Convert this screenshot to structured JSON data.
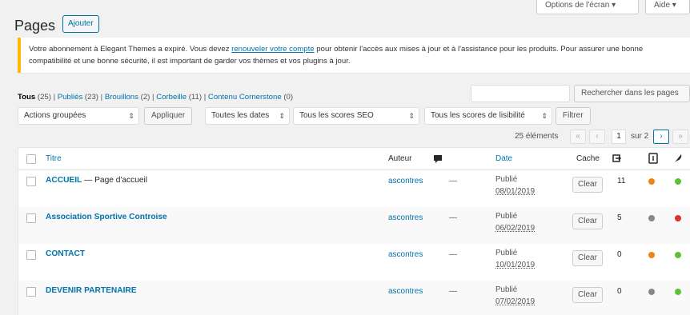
{
  "top_buttons": {
    "screen_options": "Options de l'écran ▾",
    "help": "Aide ▾"
  },
  "page": {
    "title": "Pages",
    "add_button": "Ajouter"
  },
  "notice": {
    "text_before": "Votre abonnement à Elegant Themes a expiré. Vous devez ",
    "link": "renouveler votre compte",
    "text_after": " pour obtenir l'accès aux mises à jour et à l'assistance pour les produits. Pour assurer une bonne compatibilité et une bonne sécurité, il est important de garder vos thèmes et vos plugins à jour."
  },
  "filters_links": [
    {
      "label": "Tous",
      "count": "(25)"
    },
    {
      "label": "Publiés",
      "count": "(23)"
    },
    {
      "label": "Brouillons",
      "count": "(2)"
    },
    {
      "label": "Corbeille",
      "count": "(11)"
    },
    {
      "label": "Contenu Cornerstone",
      "count": "(0)"
    }
  ],
  "search": {
    "placeholder": "",
    "button": "Rechercher dans les pages"
  },
  "toolbar": {
    "bulk_actions": "Actions groupées",
    "apply": "Appliquer",
    "dates": "Toutes les dates",
    "seo": "Tous les scores SEO",
    "readability": "Tous les scores de lisibilité",
    "filter": "Filtrer"
  },
  "pagination": {
    "items": "25 éléments",
    "current": "1",
    "of": "sur 2",
    "first": "«",
    "prev": "‹",
    "next": "›",
    "last": "»"
  },
  "columns": {
    "title": "Titre",
    "author": "Auteur",
    "date": "Date",
    "cache": "Cache"
  },
  "rows": [
    {
      "title": "ACCUEIL",
      "suffix": " — Page d'accueil",
      "author": "ascontres",
      "comments": "—",
      "status": "Publié",
      "date": "08/01/2019",
      "cache": "Clear",
      "links": "11",
      "seo": "#f0821e",
      "readability": "#5bc236"
    },
    {
      "title": "Association Sportive Controise",
      "suffix": "",
      "author": "ascontres",
      "comments": "—",
      "status": "Publié",
      "date": "06/02/2019",
      "cache": "Clear",
      "links": "5",
      "seo": "#888888",
      "readability": "#dc3232"
    },
    {
      "title": "CONTACT",
      "suffix": "",
      "author": "ascontres",
      "comments": "—",
      "status": "Publié",
      "date": "10/01/2019",
      "cache": "Clear",
      "links": "0",
      "seo": "#f0821e",
      "readability": "#5bc236"
    },
    {
      "title": "DEVENIR PARTENAIRE",
      "suffix": "",
      "author": "ascontres",
      "comments": "—",
      "status": "Publié",
      "date": "07/02/2019",
      "cache": "Clear",
      "links": "0",
      "seo": "#888888",
      "readability": "#5bc236"
    }
  ]
}
